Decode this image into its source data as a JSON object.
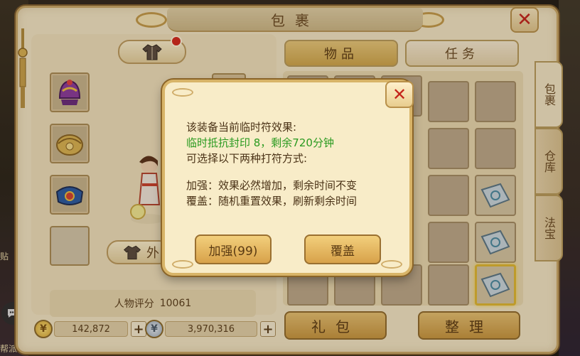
{
  "window": {
    "title": "包裹"
  },
  "left_panel": {
    "outfit_button_label": "外",
    "rating_label": "人物评分",
    "rating_value": "10061",
    "gold_amount": "142,872",
    "silver_amount": "3,970,316",
    "side_left_text": "贴",
    "bottom_left_text": "帮派",
    "equipment_icons": [
      "helmet-icon",
      "armor-icon",
      "belt-icon",
      "empty-slot"
    ]
  },
  "right_panel": {
    "tabs": [
      {
        "label": "物品",
        "active": true
      },
      {
        "label": "任务",
        "active": false
      }
    ],
    "side_tabs": [
      {
        "label": "包裹",
        "active": true
      },
      {
        "label": "仓库",
        "active": false
      },
      {
        "label": "法宝",
        "active": false
      }
    ],
    "bottom_buttons": [
      "礼包",
      "整理"
    ]
  },
  "dialog": {
    "line1": "该装备当前临时符效果:",
    "line2": "临时抵抗封印 8，剩余720分钟",
    "line3": "可选择以下两种打符方式:",
    "line4": "加强：效果必然增加，剩余时间不变",
    "line5": "覆盖：随机重置效果，刷新剩余时间",
    "strengthen_label": "加强(99)",
    "overwrite_label": "覆盖"
  },
  "colors": {
    "accent_green": "#2a9a20",
    "close_red": "#c4231a",
    "panel_bg": "#f3e6c4",
    "button_gold": "#d8a24a"
  }
}
